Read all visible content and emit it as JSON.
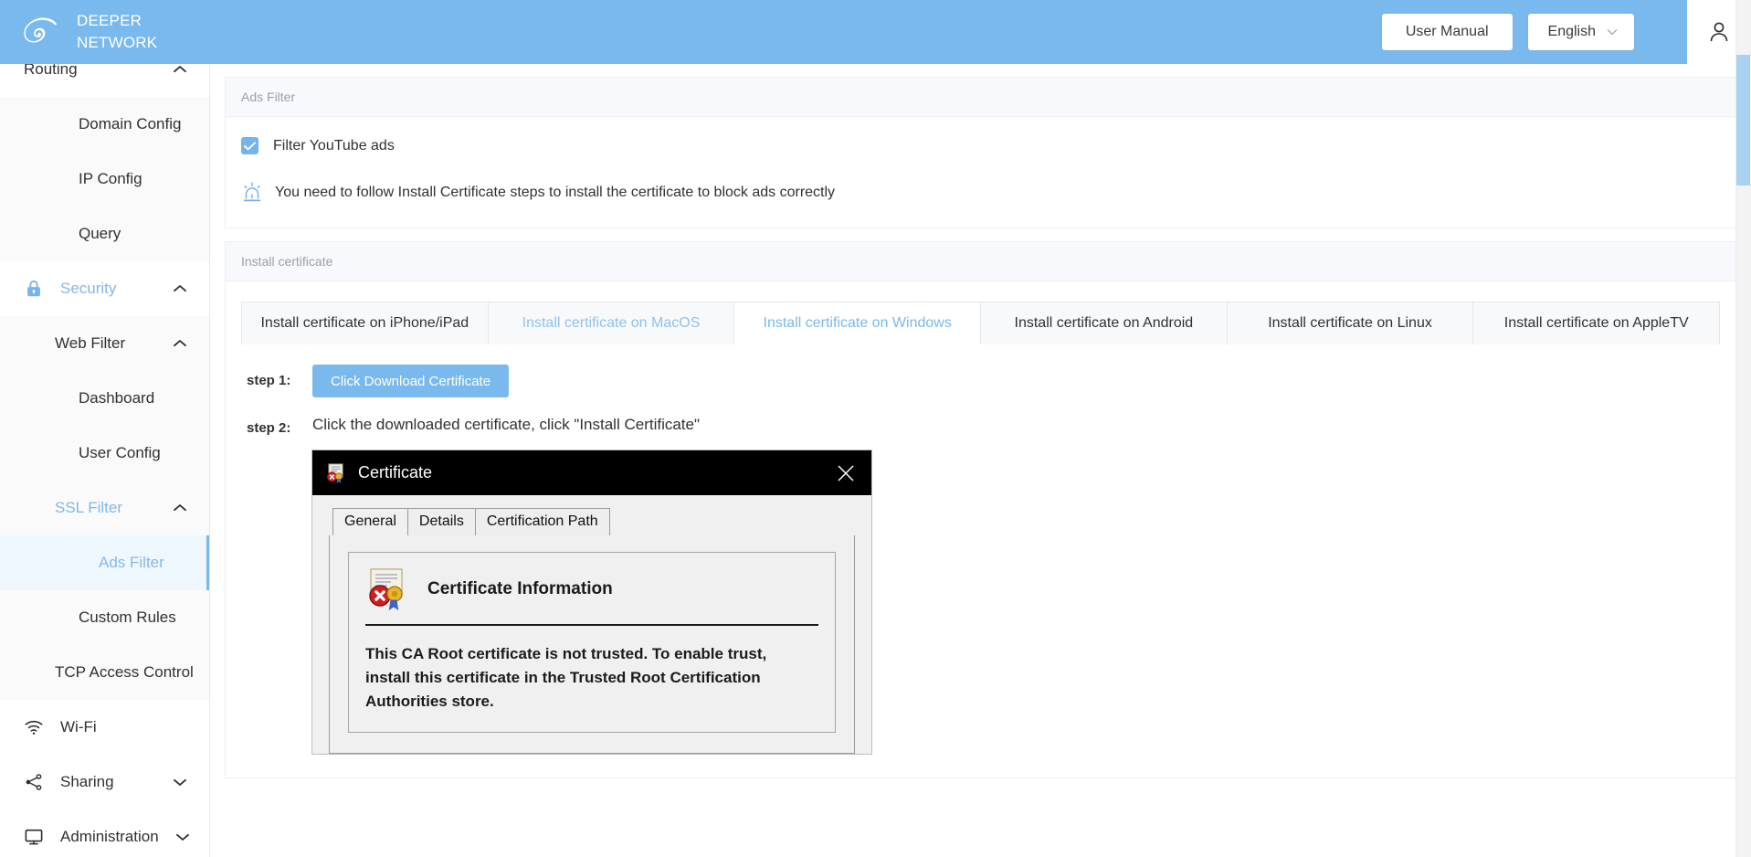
{
  "header": {
    "brand_line1": "DEEPER",
    "brand_line2": "NETWORK",
    "logo_icon": "spiral-logo-icon",
    "user_manual_label": "User Manual",
    "language_label": "English",
    "language_chevron_icon": "chevron-down-icon",
    "avatar_icon": "user-avatar-icon"
  },
  "sidebar": {
    "items": [
      {
        "label": "Routing",
        "level": "group",
        "icon": "",
        "chevron": "chevron-up-icon",
        "state": "normal"
      },
      {
        "label": "Domain Config",
        "level": "sub2",
        "icon": "",
        "chevron": "",
        "state": "normal"
      },
      {
        "label": "IP Config",
        "level": "sub2",
        "icon": "",
        "chevron": "",
        "state": "normal"
      },
      {
        "label": "Query",
        "level": "sub2",
        "icon": "",
        "chevron": "",
        "state": "normal"
      },
      {
        "label": "Security",
        "level": "group",
        "icon": "lock-icon",
        "chevron": "chevron-up-icon",
        "state": "active-text"
      },
      {
        "label": "Web Filter",
        "level": "sub1",
        "icon": "",
        "chevron": "chevron-up-icon",
        "state": "normal"
      },
      {
        "label": "Dashboard",
        "level": "sub2",
        "icon": "",
        "chevron": "",
        "state": "normal"
      },
      {
        "label": "User Config",
        "level": "sub2",
        "icon": "",
        "chevron": "",
        "state": "normal"
      },
      {
        "label": "SSL Filter",
        "level": "sub1",
        "icon": "",
        "chevron": "chevron-up-icon",
        "state": "active-text"
      },
      {
        "label": "Ads Filter",
        "level": "sub3",
        "icon": "",
        "chevron": "",
        "state": "selected"
      },
      {
        "label": "Custom Rules",
        "level": "sub2",
        "icon": "",
        "chevron": "",
        "state": "normal"
      },
      {
        "label": "TCP Access Control",
        "level": "sub1",
        "icon": "",
        "chevron": "",
        "state": "normal"
      },
      {
        "label": "Wi-Fi",
        "level": "group",
        "icon": "wifi-icon",
        "chevron": "",
        "state": "normal"
      },
      {
        "label": "Sharing",
        "level": "group",
        "icon": "share-nodes-icon",
        "chevron": "chevron-down-icon",
        "state": "normal"
      },
      {
        "label": "Administration",
        "level": "group",
        "icon": "monitor-icon",
        "chevron": "chevron-down-icon",
        "state": "normal"
      }
    ]
  },
  "ads_filter_card": {
    "title": "Ads Filter",
    "checkbox_label": "Filter YouTube ads",
    "checkbox_checked": true,
    "checkbox_color": "#74b4ec",
    "notice_icon": "siren-alarm-icon",
    "notice_text": "You need to follow Install Certificate steps to install the certificate to block ads correctly"
  },
  "install_cert_card": {
    "title": "Install certificate",
    "tabs": [
      {
        "label": "Install certificate on iPhone/iPad",
        "state": "normal"
      },
      {
        "label": "Install certificate on MacOS",
        "state": "hover"
      },
      {
        "label": "Install certificate on Windows",
        "state": "active"
      },
      {
        "label": "Install certificate on Android",
        "state": "normal"
      },
      {
        "label": "Install certificate on Linux",
        "state": "normal"
      },
      {
        "label": "Install certificate on AppleTV",
        "state": "normal"
      }
    ],
    "steps": [
      {
        "label": "step 1:",
        "button_label": "Click Download Certificate"
      },
      {
        "label": "step 2:",
        "text": "Click the downloaded certificate, click \"Install Certificate\""
      }
    ]
  },
  "cert_dialog": {
    "title": "Certificate",
    "title_icon": "certificate-error-icon",
    "close_icon": "close-icon",
    "tabs": [
      {
        "label": "General",
        "active": true
      },
      {
        "label": "Details",
        "active": false
      },
      {
        "label": "Certification Path",
        "active": false
      }
    ],
    "info_title": "Certificate Information",
    "info_icon": "certificate-seal-error-icon",
    "message": "This CA Root certificate is not trusted. To enable trust, install this certificate in the Trusted Root Certification Authorities store."
  },
  "scrollbar": {
    "orientation": "vertical",
    "thumb_color": "#a9d2f2"
  },
  "theme": {
    "accent": "#7ab9ee",
    "header_bg": "#7ab9ee",
    "sidebar_bg": "#fafafa",
    "selected_bg": "#eef7fd"
  }
}
